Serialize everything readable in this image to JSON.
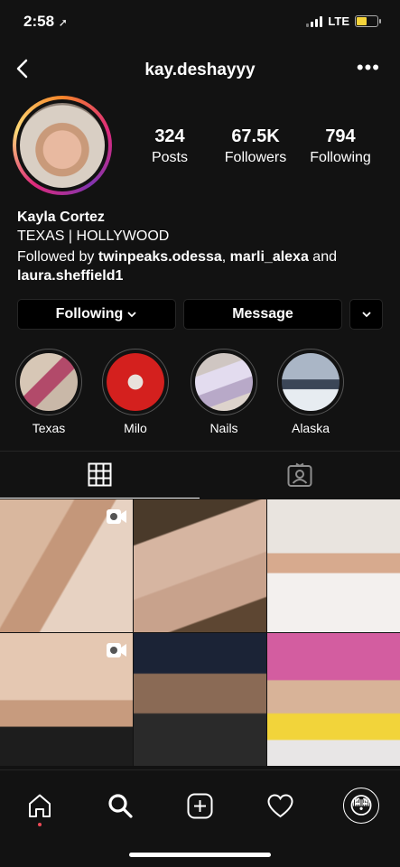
{
  "status": {
    "time": "2:58",
    "network": "LTE"
  },
  "header": {
    "username": "kay.deshayyy",
    "more_label": "•••"
  },
  "stats": [
    {
      "value": "324",
      "label": "Posts"
    },
    {
      "value": "67.5K",
      "label": "Followers"
    },
    {
      "value": "794",
      "label": "Following"
    }
  ],
  "profile": {
    "name": "Kayla Cortez",
    "bio": "TEXAS | HOLLYWOOD",
    "followed_prefix": "Followed by ",
    "followed_user1": "twinpeaks.odessa",
    "followed_sep": ", ",
    "followed_user2": "marli_alexa",
    "followed_and": " and ",
    "followed_user3": "laura.sheffield1"
  },
  "buttons": {
    "following": "Following",
    "message": "Message"
  },
  "highlights": [
    {
      "label": "Texas"
    },
    {
      "label": "Milo"
    },
    {
      "label": "Nails"
    },
    {
      "label": "Alaska"
    }
  ],
  "nav": {
    "profile_emoji": "😳"
  }
}
